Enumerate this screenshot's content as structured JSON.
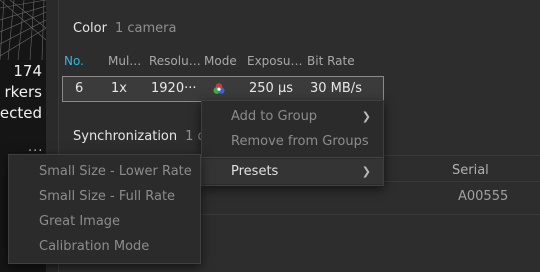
{
  "viewport": {
    "markers_count": "174",
    "markers_line": "rkers",
    "selected_line": "ected",
    "more_label": "···"
  },
  "color_section": {
    "title": "Color",
    "subtitle": "1 camera",
    "columns": [
      "No.",
      "Mul…",
      "Resolu…",
      "Mode",
      "Exposu…",
      "Bit Rate"
    ],
    "row": {
      "no": "6",
      "multiplier": "1x",
      "resolution": "1920···",
      "mode_icon": "color-wheel-icon",
      "exposure": "250 µs",
      "bit_rate": "30 MB/s"
    }
  },
  "sync_section": {
    "title": "Synchronization",
    "subtitle": "1 dev",
    "serial_header": "Serial",
    "serial_value": "A00555"
  },
  "context_menu": {
    "items": [
      {
        "label": "Add to Group",
        "has_submenu": true,
        "enabled": false
      },
      {
        "label": "Remove from Groups",
        "has_submenu": false,
        "enabled": false
      },
      {
        "label": "Presets",
        "has_submenu": true,
        "enabled": true,
        "active": true
      }
    ]
  },
  "presets_menu": {
    "items": [
      {
        "label": "Small Size - Lower Rate"
      },
      {
        "label": "Small Size - Full Rate"
      },
      {
        "label": "Great Image"
      },
      {
        "label": "Calibration Mode"
      }
    ]
  },
  "colors": {
    "accent_blue": "#32b6e6",
    "background": "#2d2d2d",
    "row_highlight": "#3b3b3b"
  }
}
